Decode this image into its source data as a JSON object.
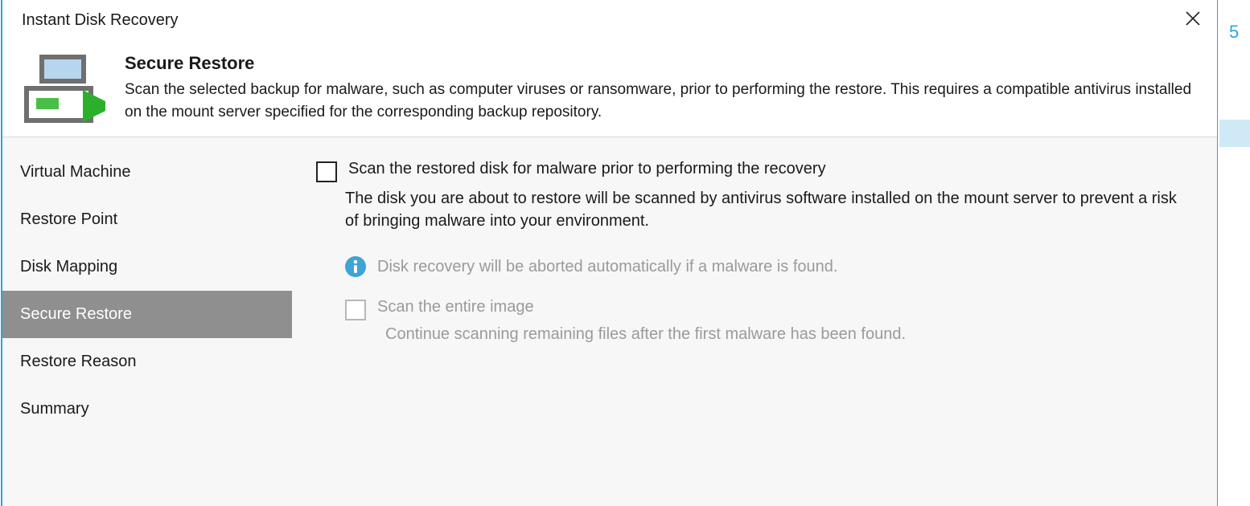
{
  "parent_fragment": "5",
  "dialog": {
    "title": "Instant Disk Recovery",
    "header": {
      "title": "Secure Restore",
      "description": "Scan the selected backup for malware, such as computer viruses or ransomware, prior to performing the restore. This requires a compatible antivirus installed on the mount server specified for the corresponding backup repository."
    },
    "sidebar": {
      "items": [
        {
          "label": "Virtual Machine",
          "selected": false
        },
        {
          "label": "Restore Point",
          "selected": false
        },
        {
          "label": "Disk Mapping",
          "selected": false
        },
        {
          "label": "Secure Restore",
          "selected": true
        },
        {
          "label": "Restore Reason",
          "selected": false
        },
        {
          "label": "Summary",
          "selected": false
        }
      ]
    },
    "content": {
      "scan_option": {
        "label": "Scan the restored disk for malware prior to performing the recovery",
        "description": "The disk you are about to restore will be scanned by antivirus software installed on the mount server to prevent a risk of bringing malware into your environment.",
        "checked": false
      },
      "info_note": "Disk recovery will be aborted automatically if a malware is found.",
      "entire_image_option": {
        "label": "Scan the entire image",
        "description": "Continue scanning remaining files after the first malware has been found.",
        "enabled": false,
        "checked": false
      }
    }
  }
}
